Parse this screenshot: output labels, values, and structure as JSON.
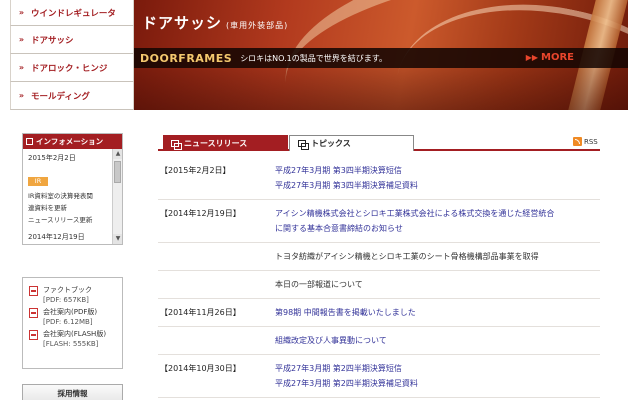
{
  "nav": {
    "items": [
      {
        "label": "ウインドレギュレータ"
      },
      {
        "label": "ドアサッシ"
      },
      {
        "label": "ドアロック・ヒンジ"
      },
      {
        "label": "モールディング"
      }
    ]
  },
  "banner": {
    "title": "ドアサッシ",
    "subtitle": "(車用外装部品)",
    "code": "DOORFRAMES",
    "slogan": "シロキはNO.1の製品で世界を結びます。",
    "more": "MORE"
  },
  "info": {
    "title": "インフォメーション",
    "entries": [
      {
        "date": "2015年2月2日",
        "badge": "IR",
        "lines": [
          "IR資料室の決算発表関",
          "連資料を更新",
          "ニュースリリース更新"
        ]
      },
      {
        "date": "2014年12月19日"
      }
    ]
  },
  "docs": [
    {
      "name": "ファクトブック",
      "size": "[PDF: 657KB]"
    },
    {
      "name": "会社案内(PDF版)",
      "size": "[PDF: 6.12MB]"
    },
    {
      "name": "会社案内(FLASH版)",
      "size": "[FLASH: 555KB]"
    }
  ],
  "recruit": "採用情報",
  "tabs": {
    "active": "ニュースリリース",
    "inactive": "トピックス"
  },
  "rss": "RSS",
  "news": [
    {
      "date": "【2015年2月2日】",
      "items": [
        "平成27年3月期 第3四半期決算短信",
        "平成27年3月期 第3四半期決算補足資料"
      ]
    },
    {
      "date": "【2014年12月19日】",
      "items": [
        "アイシン精機株式会社とシロキ工業株式会社による株式交換を通じた経営統合",
        "に関する基本合意書締結のお知らせ"
      ]
    },
    {
      "date": "",
      "items": [
        "トヨタ紡織がアイシン精機とシロキ工業のシート骨格機構部品事業を取得"
      ]
    },
    {
      "date": "",
      "items": [
        "本日の一部報道について"
      ]
    },
    {
      "date": "【2014年11月26日】",
      "items": [
        "第98期 中間報告書を掲載いたしました"
      ]
    },
    {
      "date": "",
      "items": [
        "組織改定及び人事異動について"
      ]
    },
    {
      "date": "【2014年10月30日】",
      "items": [
        "平成27年3月期 第2四半期決算短信",
        "平成27年3月期 第2四半期決算補足資料"
      ]
    }
  ]
}
